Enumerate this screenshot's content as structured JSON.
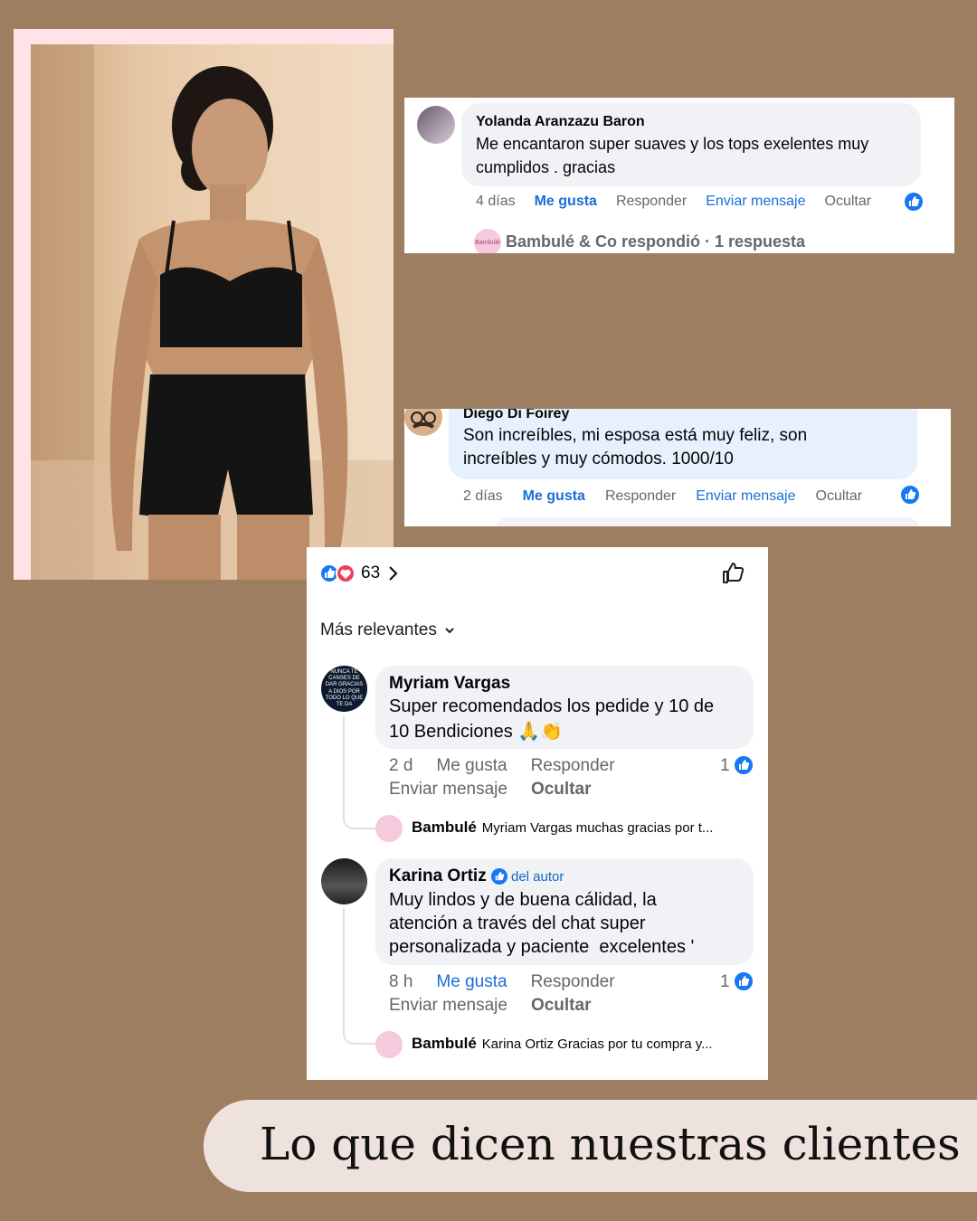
{
  "comment1": {
    "author": "Yolanda Aranzazu Baron",
    "text_line1": "Me encantaron super suaves y los tops exelentes muy",
    "text_line2": "cumplidos . gracias",
    "time": "4 días",
    "like": "Me gusta",
    "reply": "Responder",
    "message": "Enviar mensaje",
    "hide": "Ocultar",
    "reply_summary": "Bambulé & Co respondió · 1 respuesta"
  },
  "comment2": {
    "author": "Diego Di Foirey",
    "text_line1": "Son increíbles, mi esposa está muy feliz, son",
    "text_line2": "increíbles y muy cómodos. 1000/10",
    "time": "2 días",
    "like": "Me gusta",
    "reply": "Responder",
    "message": "Enviar mensaje",
    "hide": "Ocultar"
  },
  "post": {
    "reaction_count": "63",
    "sort_label": "Más relevantes",
    "comments": [
      {
        "author": "Myriam Vargas",
        "avatar_text": "NUNCA TE CANSES DE DAR GRACIAS A DIOS POR TODO LO QUE TE DA",
        "text_line1": "Super recomendados los pedide y 10 de",
        "text_line2": "10 Bendiciones 🙏👏",
        "time": "2 d",
        "like": "Me gusta",
        "reply": "Responder",
        "likes": "1",
        "message": "Enviar mensaje",
        "hide": "Ocultar",
        "reply_author": "Bambulé",
        "reply_text": "Myriam Vargas muchas gracias por t..."
      },
      {
        "author": "Karina Ortiz",
        "badge": "del autor",
        "text_line1": "Muy lindos y de buena cálidad, la",
        "text_line2": "atención a través del chat super",
        "text_line3": "personalizada y paciente  excelentes '",
        "time": "8 h",
        "like": "Me gusta",
        "reply": "Responder",
        "likes": "1",
        "message": "Enviar mensaje",
        "hide": "Ocultar",
        "reply_author": "Bambulé",
        "reply_text": "Karina Ortiz Gracias por tu compra y..."
      }
    ]
  },
  "brand_avatar_text": "Bambulé",
  "footer": {
    "title": "Lo que dicen nuestras clientes"
  },
  "colors": {
    "background": "#9e7e61",
    "facebook_blue": "#1877f2",
    "footer_bg": "#eee3dc"
  }
}
